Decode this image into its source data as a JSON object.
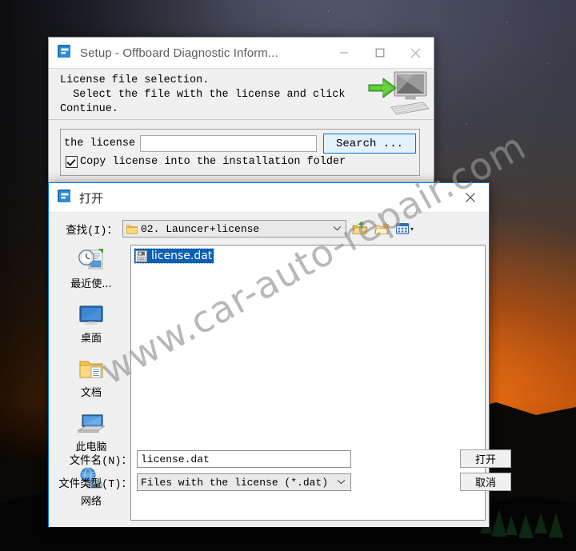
{
  "desktop": {
    "wallpaper_description": "night sky with stars over orange sunset horizon and dark mountain silhouette",
    "colors": {
      "sky_top": "#3d4050",
      "sunset_glow": "#c45d0e",
      "silhouette": "#090806"
    }
  },
  "watermark": {
    "text": "www.car-auto-repair.com",
    "color": "#7d7d7d"
  },
  "setup_window": {
    "title": "Setup - Offboard Diagnostic Inform...",
    "icon": "app-icon",
    "controls": {
      "minimize": "–",
      "maximize": "□",
      "close": "✕"
    },
    "heading_line1": "License file selection.",
    "heading_line2": "  Select the file with the license and click",
    "heading_line3": "Continue.",
    "banner_icon": "computer-import-icon",
    "license_field": {
      "label": "the license",
      "value": "",
      "placeholder": ""
    },
    "search_button": {
      "label": "Search ..."
    },
    "copy_checkbox": {
      "label": "Copy license into the installation folder",
      "checked": true
    },
    "accent_color": "#0078d7"
  },
  "open_dialog": {
    "title": "打开",
    "icon": "app-icon",
    "close_label": "✕",
    "lookin": {
      "label": "查找(I)：",
      "value": "02. Launcer+license",
      "folder_icon": "folder-icon",
      "chevron": "⌵"
    },
    "toolbar": [
      {
        "name": "up-one-level-icon",
        "title": "up-one-level"
      },
      {
        "name": "new-folder-icon",
        "title": "create-new-folder"
      },
      {
        "name": "view-menu-icon",
        "title": "change-view"
      }
    ],
    "view_chevron": "▾",
    "places": [
      {
        "label": "最近使...",
        "icon": "recent-items-icon"
      },
      {
        "label": "桌面",
        "icon": "desktop-icon"
      },
      {
        "label": "文档",
        "icon": "documents-folder-icon"
      },
      {
        "label": "此电脑",
        "icon": "this-pc-icon"
      },
      {
        "label": "网络",
        "icon": "network-icon"
      }
    ],
    "files": [
      {
        "name": "license.dat",
        "icon": "dat-file-icon",
        "selected": true
      }
    ],
    "filename": {
      "label": "文件名(N)：",
      "value": "license.dat"
    },
    "filetype": {
      "label": "文件类型(T)：",
      "value": "Files with the license (*.dat)",
      "chevron": "⌵"
    },
    "buttons": {
      "open": "打开",
      "cancel": "取消"
    },
    "border_color": "#0078d7",
    "selection_color": "#0a5fb4"
  }
}
